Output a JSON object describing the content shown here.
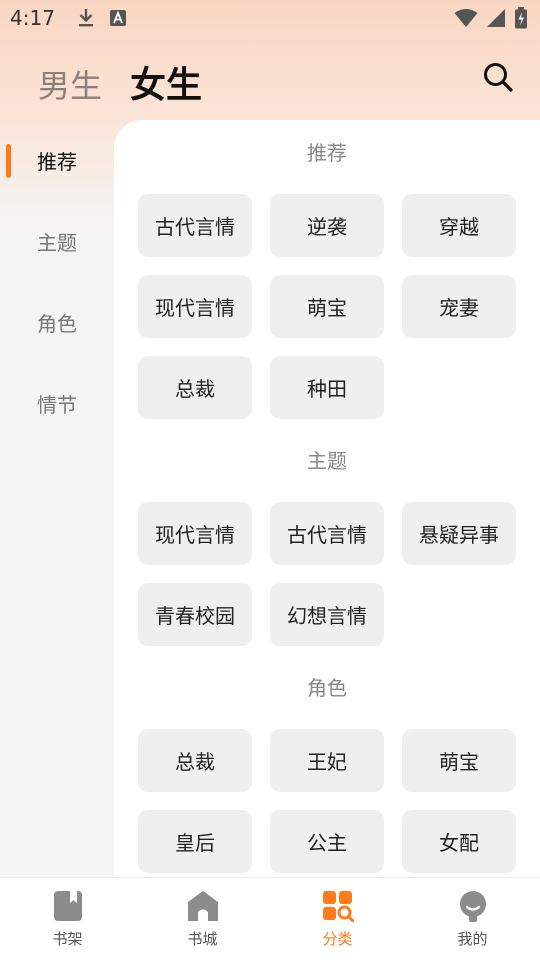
{
  "status_bar": {
    "time": "4:17"
  },
  "header": {
    "tabs": [
      {
        "label": "男生"
      },
      {
        "label": "女生"
      }
    ],
    "active_tab": "女生"
  },
  "side_nav": {
    "items": [
      {
        "label": "推荐"
      },
      {
        "label": "主题"
      },
      {
        "label": "角色"
      },
      {
        "label": "情节"
      }
    ],
    "active": "推荐"
  },
  "sections": [
    {
      "title": "推荐",
      "chips": [
        "古代言情",
        "逆袭",
        "穿越",
        "现代言情",
        "萌宝",
        "宠妻",
        "总裁",
        "种田"
      ]
    },
    {
      "title": "主题",
      "chips": [
        "现代言情",
        "古代言情",
        "悬疑异事",
        "青春校园",
        "幻想言情"
      ]
    },
    {
      "title": "角色",
      "chips": [
        "总裁",
        "王妃",
        "萌宝",
        "皇后",
        "公主",
        "女配"
      ]
    }
  ],
  "bottom_nav": {
    "items": [
      {
        "label": "书架",
        "icon": "bookshelf-icon"
      },
      {
        "label": "书城",
        "icon": "bookstore-icon"
      },
      {
        "label": "分类",
        "icon": "category-icon"
      },
      {
        "label": "我的",
        "icon": "profile-icon"
      }
    ],
    "active": "分类"
  },
  "colors": {
    "accent": "#ff7a1a",
    "chip_bg": "#efefef",
    "icon_gray": "#8c8c8c"
  }
}
